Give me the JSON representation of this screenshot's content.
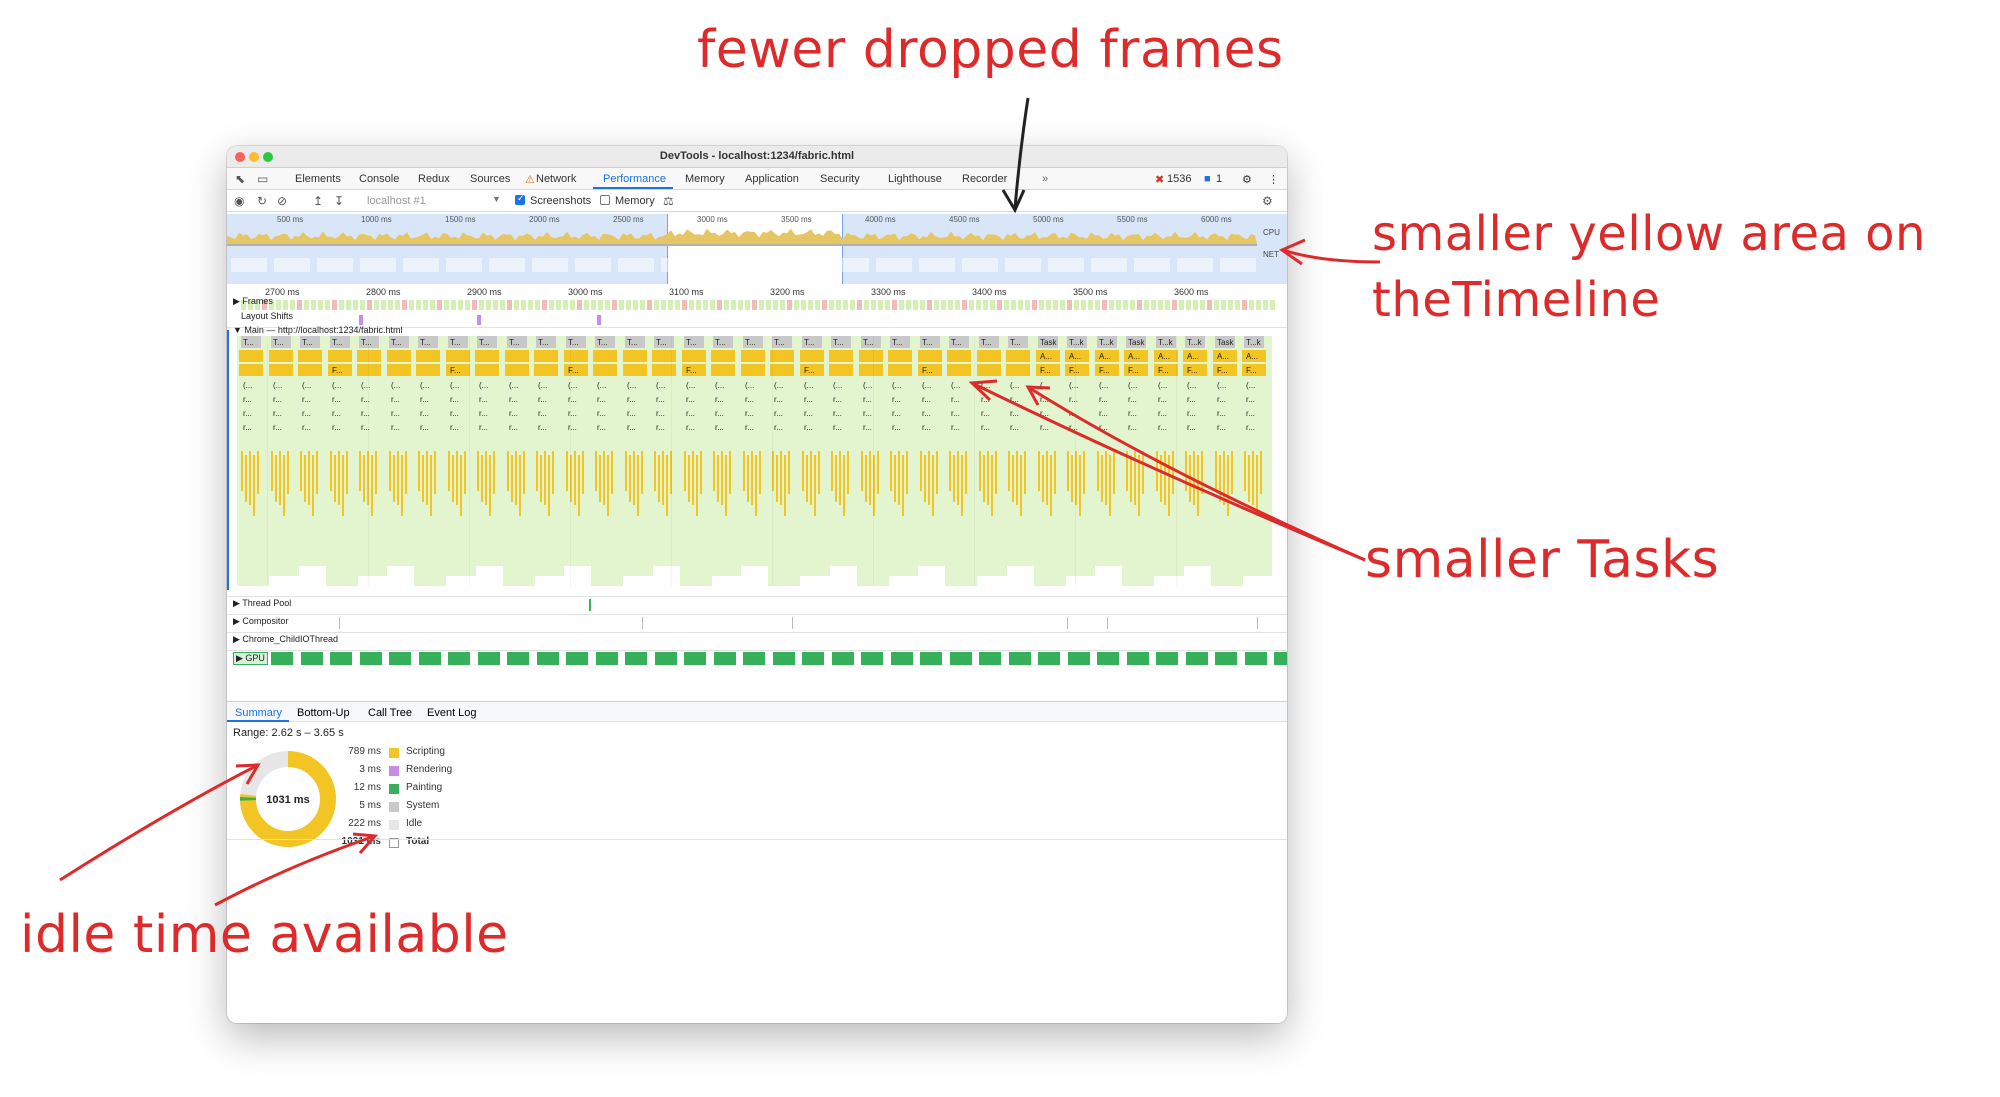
{
  "window": {
    "title": "DevTools - localhost:1234/fabric.html"
  },
  "tabs": [
    {
      "label": "Elements",
      "name": "tab-elements"
    },
    {
      "label": "Console",
      "name": "tab-console"
    },
    {
      "label": "Redux",
      "name": "tab-redux"
    },
    {
      "label": "Sources",
      "name": "tab-sources"
    },
    {
      "label": "Network",
      "name": "tab-network"
    },
    {
      "label": "Performance",
      "name": "tab-performance"
    },
    {
      "label": "Memory",
      "name": "tab-memory"
    },
    {
      "label": "Application",
      "name": "tab-application"
    },
    {
      "label": "Security",
      "name": "tab-security"
    },
    {
      "label": "Lighthouse",
      "name": "tab-lighthouse"
    },
    {
      "label": "Recorder",
      "name": "tab-recorder"
    }
  ],
  "status": {
    "errors": "1536",
    "messages": "1"
  },
  "toolbar": {
    "target": "localhost #1",
    "screenshots_label": "Screenshots",
    "screenshots_checked": true,
    "memory_label": "Memory",
    "memory_checked": false
  },
  "overview": {
    "ticks": [
      "500 ms",
      "1000 ms",
      "1500 ms",
      "2000 ms",
      "2500 ms",
      "3000 ms",
      "3500 ms",
      "4000 ms",
      "4500 ms",
      "5000 ms",
      "5500 ms",
      "6000 ms"
    ],
    "cpu_label": "CPU",
    "net_label": "NET"
  },
  "ruler": [
    "2700 ms",
    "2800 ms",
    "2900 ms",
    "3000 ms",
    "3100 ms",
    "3200 ms",
    "3300 ms",
    "3400 ms",
    "3500 ms",
    "3600 ms"
  ],
  "tracks": {
    "frames": "Frames",
    "layout_shifts": "Layout Shifts",
    "main": "Main — http://localhost:1234/fabric.html",
    "thread_pool": "Thread Pool",
    "compositor": "Compositor",
    "child_io": "Chrome_ChildIOThread",
    "gpu": "GPU"
  },
  "flame": {
    "task_short": "T...",
    "task_full": "Task",
    "task_k": "T...k",
    "f_label": "F...",
    "a_label": "A...",
    "paren_label": "(...",
    "r_label": "r...",
    "rt_label": "r...t",
    "rl_label": "r...l"
  },
  "bottom_tabs": [
    "Summary",
    "Bottom-Up",
    "Call Tree",
    "Event Log"
  ],
  "summary": {
    "range": "Range: 2.62 s – 3.65 s",
    "total_center": "1031 ms",
    "rows": [
      {
        "value": "789 ms",
        "label": "Scripting",
        "color": "#f2c525"
      },
      {
        "value": "3 ms",
        "label": "Rendering",
        "color": "#c78be8"
      },
      {
        "value": "12 ms",
        "label": "Painting",
        "color": "#36b05b"
      },
      {
        "value": "5 ms",
        "label": "System",
        "color": "#c9c9c9"
      },
      {
        "value": "222 ms",
        "label": "Idle",
        "color": "#e6e6e6"
      },
      {
        "value": "1031 ms",
        "label": "Total",
        "color": "#ffffff"
      }
    ]
  },
  "annotations": {
    "fewer_dropped": "fewer dropped frames",
    "yellow_line1": "smaller yellow area on",
    "yellow_line2": "theTimeline",
    "smaller_tasks": "smaller Tasks",
    "idle_time": "idle time available"
  },
  "colors": {
    "accent": "#1a73e8",
    "scripting": "#f2c525",
    "task_gray": "#c8c8c8",
    "frame_green": "#d5f0b5",
    "gpu": "#36b05b",
    "annotation": "#dd2a2a"
  }
}
